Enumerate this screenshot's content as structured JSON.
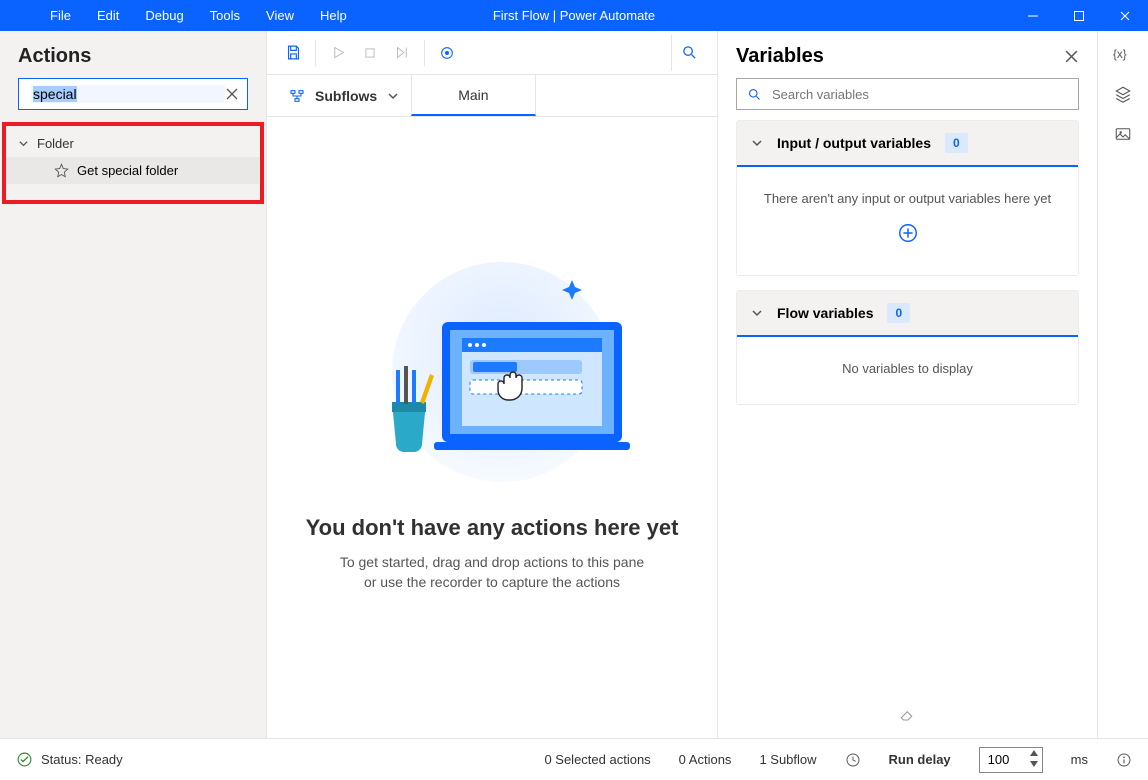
{
  "menubar": {
    "items": [
      "File",
      "Edit",
      "Debug",
      "Tools",
      "View",
      "Help"
    ]
  },
  "window_title": "First Flow | Power Automate",
  "actions": {
    "title": "Actions",
    "search_value": "special",
    "tree": {
      "group": "Folder",
      "items": [
        "Get special folder"
      ]
    }
  },
  "workspace": {
    "subflows_label": "Subflows",
    "tabs": [
      "Main"
    ],
    "empty": {
      "title": "You don't have any actions here yet",
      "line1": "To get started, drag and drop actions to this pane",
      "line2": "or use the recorder to capture the actions"
    }
  },
  "variables": {
    "title": "Variables",
    "search_placeholder": "Search variables",
    "io_section": {
      "label": "Input / output variables",
      "count": "0",
      "message": "There aren't any input or output variables here yet"
    },
    "flow_section": {
      "label": "Flow variables",
      "count": "0",
      "message": "No variables to display"
    }
  },
  "statusbar": {
    "status": "Status: Ready",
    "selected": "0 Selected actions",
    "actions": "0 Actions",
    "subflows": "1 Subflow",
    "run_delay_label": "Run delay",
    "run_delay_value": "100",
    "run_delay_unit": "ms"
  }
}
